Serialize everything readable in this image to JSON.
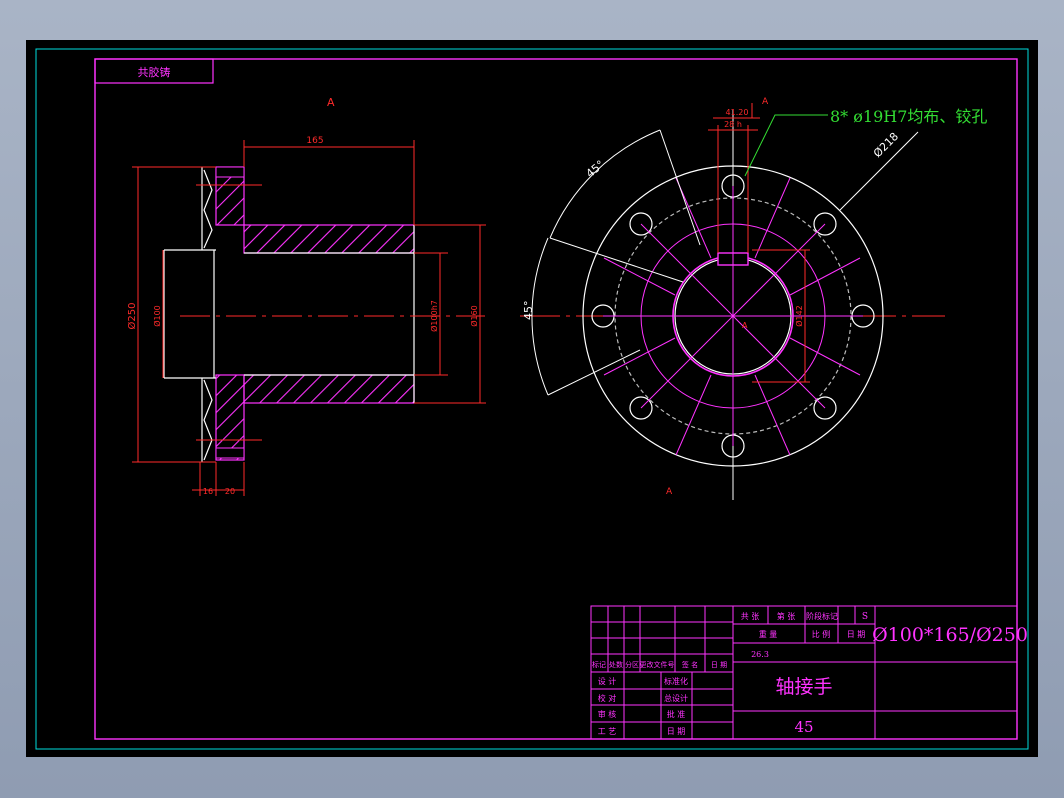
{
  "title_stamp": "共胶铸",
  "view_label": "A",
  "section_marks": [
    "A",
    "A"
  ],
  "dims": {
    "length": "165",
    "outer_dia": "Ø250",
    "inner_bore": "Ø100",
    "hub_dia": "Ø100h7",
    "hub_outer": "Ø160",
    "flange_thk": "16",
    "flange_w": "20",
    "keyway_w": "28 h",
    "keyway_d": "41.20",
    "angle_a": "45°",
    "angle_b": "45°",
    "pcd": "Ø218",
    "center_dim": "Ø142",
    "center_mark": "A"
  },
  "hole_note": "8* ø19H7均布、铰孔",
  "title_block": {
    "spec": "Ø100*165/Ø250",
    "part_name": "轴接手",
    "material": "45",
    "mass": "26.3",
    "header": [
      "共 张",
      "第 张",
      "阶段标记",
      "S"
    ],
    "weight_row": [
      "重 量",
      "比 例",
      "日 期"
    ],
    "rev_row": [
      "标记",
      "处数",
      "分区",
      "更改文件号",
      "签 名",
      "日 期"
    ],
    "sign_left": [
      "设 计",
      "校 对",
      "审 核",
      "工 艺"
    ],
    "sign_mid": [
      "标准化",
      "总设计",
      "批 准",
      "日 期"
    ]
  }
}
